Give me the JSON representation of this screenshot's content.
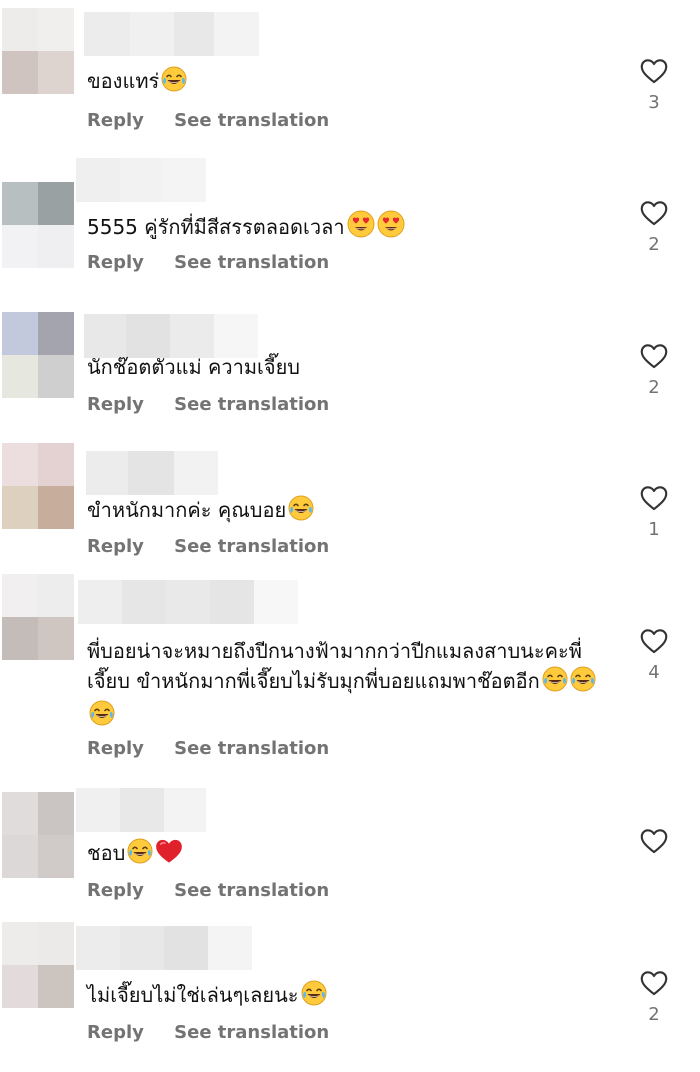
{
  "comments": [
    {
      "text": "ของแทร่",
      "emoji": [
        "laugh"
      ],
      "reply": "Reply",
      "translate": "See translation",
      "likes": "3"
    },
    {
      "text": "5555 คู่รักที่มีสีสรรตลอดเวลา",
      "emoji": [
        "heart-eyes",
        "heart-eyes"
      ],
      "reply": "Reply",
      "translate": "See translation",
      "likes": "2"
    },
    {
      "text": "นักช๊อตตัวแม่ ความเจี๊ยบ",
      "emoji": [],
      "reply": "Reply",
      "translate": "See translation",
      "likes": "2"
    },
    {
      "text": "ขำหนักมากค่ะ คุณบอย",
      "emoji": [
        "laugh"
      ],
      "reply": "Reply",
      "translate": "See translation",
      "likes": "1"
    },
    {
      "text": "พี่บอยน่าจะหมายถึงปีกนางฟ้ามากกว่าปีกแมลงสาบนะคะพี่เจี๊ยบ ขำหนักมากพี่เจี๊ยบไม่รับมุกพี่บอยแถมพาช๊อตอีก",
      "emoji": [
        "laugh",
        "laugh",
        "laugh"
      ],
      "reply": "Reply",
      "translate": "See translation",
      "likes": "4"
    },
    {
      "text": "ชอบ",
      "emoji": [
        "laugh",
        "red-heart"
      ],
      "reply": "Reply",
      "translate": "See translation",
      "likes": ""
    },
    {
      "text": "ไม่เจี๊ยบไม่ใช่เล่นๆเลยนะ",
      "emoji": [
        "laugh"
      ],
      "reply": "Reply",
      "translate": "See translation",
      "likes": "2"
    }
  ],
  "icons": {
    "like": "heart-outline-icon",
    "emoji_laugh": "tears-of-joy-emoji",
    "emoji_heart_eyes": "heart-eyes-emoji",
    "emoji_red_heart": "red-heart-emoji"
  },
  "colors": {
    "text": "#111111",
    "secondary": "#737373",
    "background": "#ffffff"
  }
}
